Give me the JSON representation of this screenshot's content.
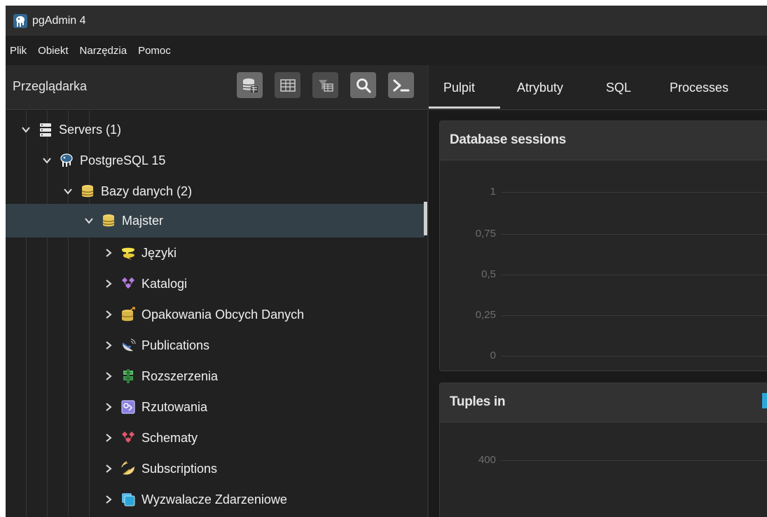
{
  "app": {
    "title": "pgAdmin 4"
  },
  "menu": [
    "Plik",
    "Obiekt",
    "Narzędzia",
    "Pomoc"
  ],
  "browser": {
    "title": "Przeglądarka",
    "toolbar": [
      "object-explorer-icon",
      "table-grid-icon",
      "filtered-rows-icon",
      "search-icon",
      "terminal-icon"
    ]
  },
  "tree": [
    {
      "label": "Servers (1)",
      "icon": "servers-icon"
    },
    {
      "label": "PostgreSQL 15",
      "icon": "postgresql-elephant-icon"
    },
    {
      "label": "Bazy danych (2)",
      "icon": "databases-icon"
    },
    {
      "label": "Majster",
      "icon": "database-icon",
      "selected": true
    },
    {
      "label": "Języki",
      "icon": "languages-icon"
    },
    {
      "label": "Katalogi",
      "icon": "catalogs-icon"
    },
    {
      "label": "Opakowania Obcych Danych",
      "icon": "foreign-data-wrappers-icon"
    },
    {
      "label": "Publications",
      "icon": "publications-icon"
    },
    {
      "label": "Rozszerzenia",
      "icon": "extensions-icon"
    },
    {
      "label": "Rzutowania",
      "icon": "casts-icon"
    },
    {
      "label": "Schematy",
      "icon": "schemas-icon"
    },
    {
      "label": "Subscriptions",
      "icon": "subscriptions-icon"
    },
    {
      "label": "Wyzwalacze Zdarzeniowe",
      "icon": "event-triggers-icon"
    }
  ],
  "tabs": [
    "Pulpit",
    "Atrybuty",
    "SQL",
    "Processes"
  ],
  "active_tab": "Pulpit",
  "dashboard": {
    "panels": [
      {
        "title": "Database sessions",
        "yticks": [
          "1",
          "0,75",
          "0,5",
          "0,25",
          "0"
        ]
      },
      {
        "title": "Tuples in",
        "yticks": [
          "400"
        ]
      }
    ]
  },
  "colors": {
    "accent_blue": "#2aa7d8",
    "selection": "#334048",
    "db_gold": "#e8c75a"
  }
}
